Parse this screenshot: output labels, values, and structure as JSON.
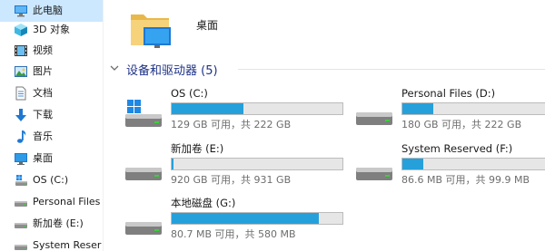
{
  "colors": {
    "selection": "#cce8ff",
    "bar_fill": "#26a0da",
    "group_title": "#1e3287",
    "muted_text": "#6d6d6d"
  },
  "nav": {
    "items": [
      {
        "label": "此电脑",
        "icon": "computer-icon",
        "selected": true
      },
      {
        "label": "3D 对象",
        "icon": "cube-3d-icon"
      },
      {
        "label": "视频",
        "icon": "video-icon"
      },
      {
        "label": "图片",
        "icon": "pictures-icon"
      },
      {
        "label": "文档",
        "icon": "document-icon"
      },
      {
        "label": "下载",
        "icon": "download-icon"
      },
      {
        "label": "音乐",
        "icon": "music-icon"
      },
      {
        "label": "桌面",
        "icon": "desktop-icon"
      },
      {
        "label": "OS (C:)",
        "icon": "windows-drive-icon"
      },
      {
        "label": "Personal Files",
        "icon": "drive-icon"
      },
      {
        "label": "新加卷 (E:)",
        "icon": "drive-icon"
      },
      {
        "label": "System Reser",
        "icon": "drive-icon"
      }
    ]
  },
  "content": {
    "desktop_folder": {
      "label": "桌面",
      "icon": "desktop-folder-icon"
    },
    "devices_group": {
      "title": "设备和驱动器 (5)",
      "icon": "chevron-down-icon"
    },
    "drives": [
      {
        "name": "OS (C:)",
        "free_text": "129 GB 可用，共 222 GB",
        "used_fraction": 0.42,
        "icon": "windows-drive-icon"
      },
      {
        "name": "Personal Files (D:)",
        "free_text": "180 GB 可用，共 222 GB",
        "used_fraction": 0.19,
        "icon": "drive-icon"
      },
      {
        "name": "新加卷 (E:)",
        "free_text": "920 GB 可用，共 931 GB",
        "used_fraction": 0.012,
        "icon": "drive-icon"
      },
      {
        "name": "System Reserved (F:)",
        "free_text": "86.6 MB 可用，共 99.9 MB",
        "used_fraction": 0.13,
        "icon": "drive-icon"
      },
      {
        "name": "本地磁盘 (G:)",
        "free_text": "80.7 MB 可用，共 580 MB",
        "used_fraction": 0.86,
        "icon": "drive-icon"
      }
    ]
  }
}
